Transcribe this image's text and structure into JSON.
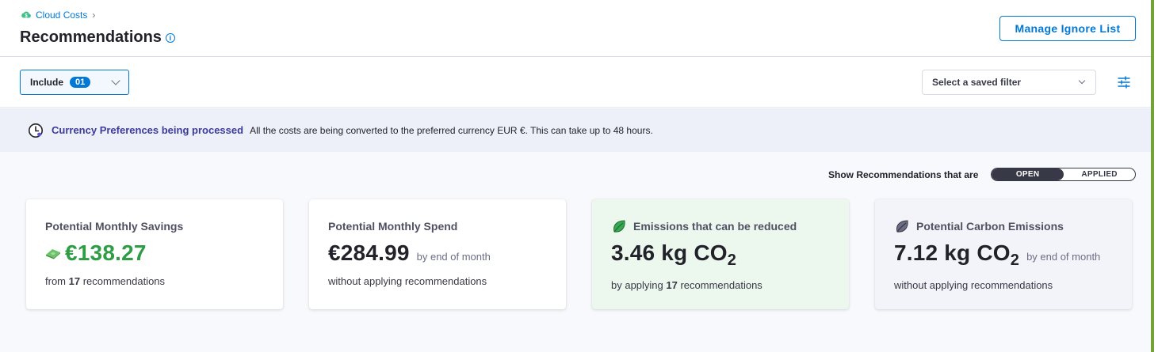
{
  "breadcrumb": {
    "label": "Cloud Costs",
    "separator": "›"
  },
  "page": {
    "title": "Recommendations"
  },
  "header": {
    "manage_ignore_label": "Manage Ignore List"
  },
  "filters": {
    "include_label": "Include",
    "include_count": "01",
    "saved_filter_placeholder": "Select a saved filter"
  },
  "banner": {
    "title": "Currency Preferences being processed",
    "text": "All the costs are being converted to the preferred currency EUR €. This can take up to 48 hours."
  },
  "toggle": {
    "label": "Show Recommendations that are",
    "options": [
      "OPEN",
      "APPLIED"
    ],
    "selected": "OPEN"
  },
  "cards": [
    {
      "title": "Potential Monthly Savings",
      "value": "€138.27",
      "suffix": "",
      "sub_prefix": "from ",
      "sub_count": "17",
      "sub_suffix": " recommendations"
    },
    {
      "title": "Potential Monthly Spend",
      "value": "€284.99",
      "suffix": "by end of month",
      "sub_text": "without applying recommendations"
    },
    {
      "title": "Emissions that can be reduced",
      "value": "3.46 kg CO",
      "value_sub": "2",
      "sub_prefix": "by applying ",
      "sub_count": "17",
      "sub_suffix": " recommendations"
    },
    {
      "title": "Potential Carbon Emissions",
      "value": "7.12 kg CO",
      "value_sub": "2",
      "suffix": "by end of month",
      "sub_text": "without applying recommendations"
    }
  ],
  "icons": {
    "breadcrumb": "cloud-costs-icon",
    "info": "info-icon",
    "filter": "filter-settings-icon",
    "banner": "clock-icon",
    "savings": "money-icon",
    "emissions_reduced": "green-leaf-icon",
    "carbon": "grey-leaf-icon"
  },
  "colors": {
    "accent": "#0278d5",
    "savings": "#2e9d45",
    "green_card": "#ecf7ee",
    "banner_title": "#3c3c9a",
    "side_stripe": "#72a336"
  }
}
